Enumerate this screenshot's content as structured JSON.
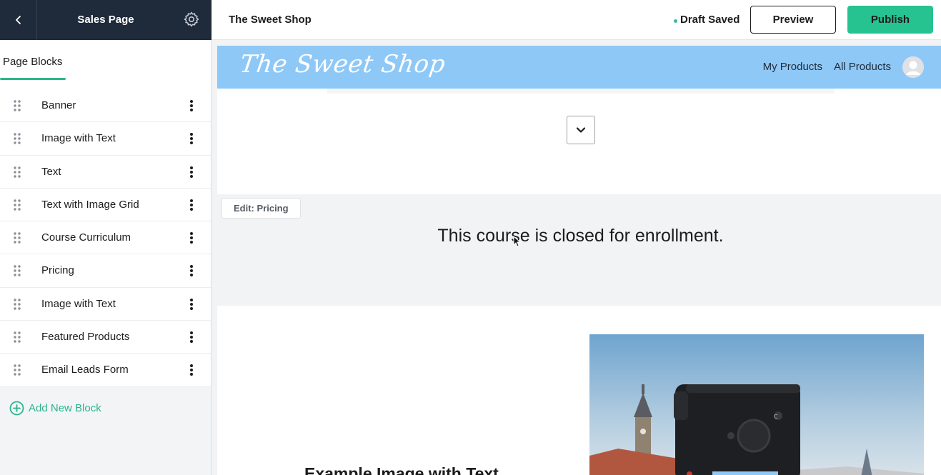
{
  "sidebar": {
    "title": "Sales Page",
    "tab": "Page Blocks",
    "blocks": [
      {
        "label": "Banner"
      },
      {
        "label": "Image with Text"
      },
      {
        "label": "Text"
      },
      {
        "label": "Text with Image Grid"
      },
      {
        "label": "Course Curriculum"
      },
      {
        "label": "Pricing"
      },
      {
        "label": "Image with Text"
      },
      {
        "label": "Featured Products"
      },
      {
        "label": "Email Leads Form"
      }
    ],
    "add_block_label": "Add New Block"
  },
  "topbar": {
    "title": "The Sweet Shop",
    "status": "Draft Saved",
    "preview_label": "Preview",
    "publish_label": "Publish"
  },
  "site": {
    "logo_text": "The Sweet Shop",
    "nav": [
      "My Products",
      "All Products"
    ]
  },
  "pricing_section": {
    "edit_label": "Edit: Pricing",
    "message": "This course is closed for enrollment."
  },
  "image_text_section": {
    "heading": "Example Image with Text"
  },
  "colors": {
    "sidebar_header": "#1f2a3a",
    "accent": "#26c28f",
    "site_header": "#8ec8f7"
  }
}
